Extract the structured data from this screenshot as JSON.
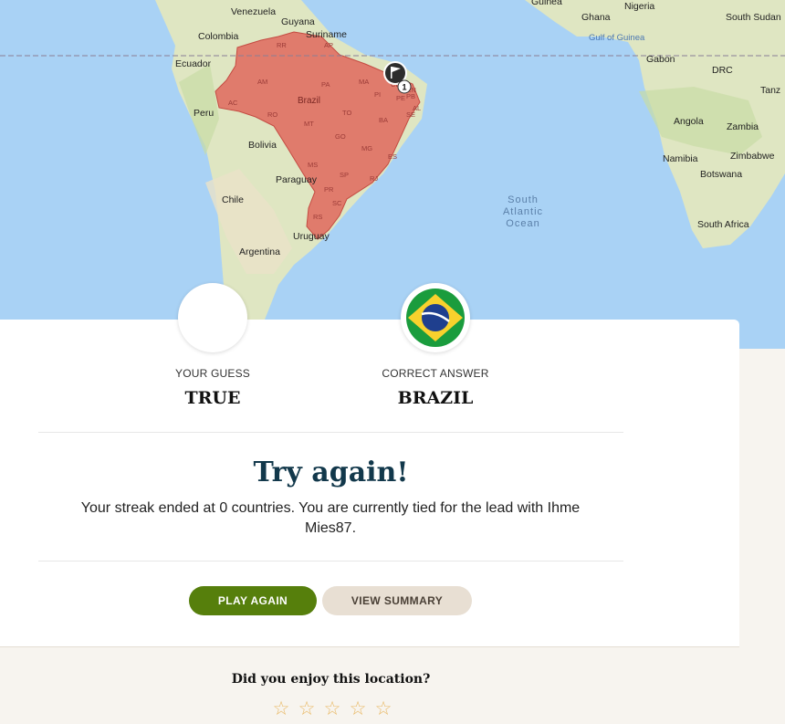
{
  "map": {
    "labels": {
      "venezuela": "Venezuela",
      "guyana": "Guyana",
      "suriname": "Suriname",
      "colombia": "Colombia",
      "ecuador": "Ecuador",
      "peru": "Peru",
      "brazil": "Brazil",
      "bolivia": "Bolivia",
      "paraguay": "Paraguay",
      "chile": "Chile",
      "argentina": "Argentina",
      "uruguay": "Uruguay",
      "ocean_line1": "South",
      "ocean_line2": "Atlantic",
      "ocean_line3": "Ocean",
      "gulf": "Gulf of Guinea",
      "guinea": "Guinea",
      "ghana": "Ghana",
      "nigeria": "Nigeria",
      "south_sudan": "South Sudan",
      "gabon": "Gabon",
      "drc": "DRC",
      "tanzania": "Tanz",
      "angola": "Angola",
      "zambia": "Zambia",
      "zimbabwe": "Zimbabwe",
      "namibia": "Namibia",
      "botswana": "Botswana",
      "south_africa": "South Africa"
    },
    "states": [
      "RR",
      "AP",
      "AM",
      "PA",
      "MA",
      "CE",
      "PI",
      "RN",
      "PB",
      "PE",
      "AC",
      "RO",
      "TO",
      "AL",
      "BA",
      "SE",
      "MT",
      "GO",
      "MG",
      "ES",
      "MS",
      "SP",
      "RJ",
      "PR",
      "SC",
      "RS"
    ],
    "guess_marker_number": "1",
    "highlight_color": "#e0675d"
  },
  "result": {
    "your_guess_label": "YOUR GUESS",
    "your_guess_value": "TRUE",
    "correct_answer_label": "CORRECT ANSWER",
    "correct_answer_value": "BRAZIL",
    "title": "Try again!",
    "message": "Your streak ended at 0 countries. You are currently tied for the lead with Ihme Mies87."
  },
  "buttons": {
    "play_again": "PLAY AGAIN",
    "view_summary": "VIEW SUMMARY"
  },
  "rating": {
    "question": "Did you enjoy this location?",
    "stars": [
      "☆",
      "☆",
      "☆",
      "☆",
      "☆"
    ]
  },
  "colors": {
    "primary": "#567f0c",
    "secondary": "#e8dfd3",
    "title": "#12384b"
  }
}
